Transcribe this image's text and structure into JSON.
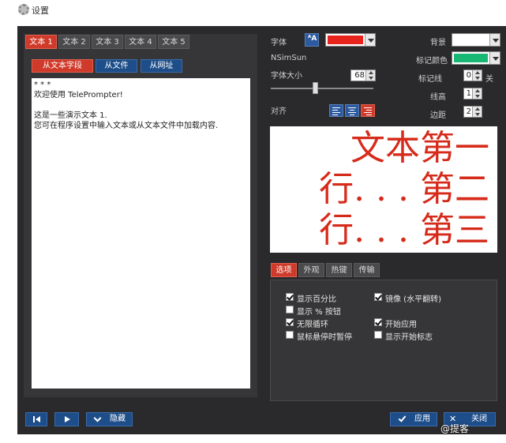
{
  "window": {
    "title": "设置"
  },
  "text_tabs": [
    "文本 1",
    "文本 2",
    "文本 3",
    "文本 4",
    "文本 5"
  ],
  "source_buttons": [
    "从文本字段",
    "从文件",
    "从网址"
  ],
  "editor_lines": [
    "* * *",
    "欢迎使用 TelePrompter!",
    "",
    "这是一些演示文本 1.",
    "您可在程序设置中输入文本或从文本文件中加载内容."
  ],
  "font": {
    "label": "字体",
    "name": "NSimSun",
    "size_label": "字体大小",
    "size": "68",
    "color": "#e8231b"
  },
  "align_label": "对齐",
  "right_settings": {
    "background_label": "背景",
    "background_color": "#ffffff",
    "marker_color_label": "标记颜色",
    "marker_color": "#19b774",
    "marker_line_label": "标记线",
    "marker_line_value": "0",
    "marker_line_state": "关",
    "line_height_label": "线高",
    "line_height_value": "1",
    "margin_label": "边距",
    "margin_value": "2"
  },
  "preview_lines": [
    "文本第一",
    "行. . . 第二",
    "行. . . 第三"
  ],
  "option_tabs": [
    "选项",
    "外观",
    "热键",
    "传输"
  ],
  "options": [
    {
      "label": "显示百分比",
      "checked": true
    },
    {
      "label": "镜像 (水平翻转)",
      "checked": true
    },
    {
      "label": "显示 % 按钮",
      "checked": false
    },
    {
      "label": "无限循环",
      "checked": true
    },
    {
      "label": "开始应用",
      "checked": true
    },
    {
      "label": "鼠标悬停时暂停",
      "checked": false
    },
    {
      "label": "显示开始标志",
      "checked": false
    }
  ],
  "bottom": {
    "hide_label": "隐藏",
    "apply_label": "应用",
    "close_label": "关闭"
  },
  "watermark": "@提客"
}
